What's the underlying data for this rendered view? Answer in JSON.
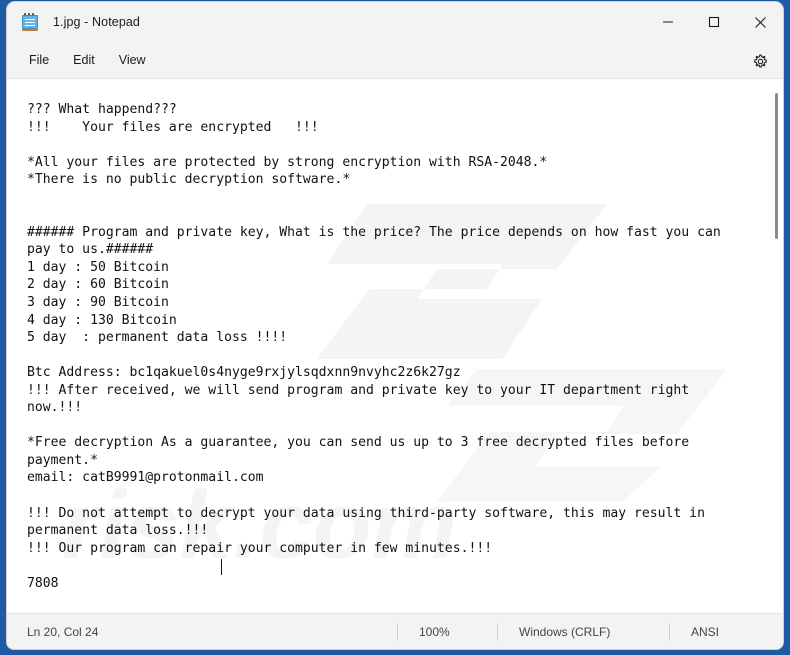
{
  "desktop": {
    "background_color": "#1f5aa6"
  },
  "window": {
    "title": "1.jpg - Notepad",
    "app_icon": "notepad-icon",
    "controls": {
      "minimize": "minimize-icon",
      "maximize": "maximize-icon",
      "close": "close-icon"
    }
  },
  "menubar": {
    "items": [
      {
        "label": "File"
      },
      {
        "label": "Edit"
      },
      {
        "label": "View"
      }
    ],
    "settings_icon": "gear-icon"
  },
  "editor": {
    "content": "??? What happend???\n!!!    Your files are encrypted   !!!\n\n*All your files are protected by strong encryption with RSA-2048.*\n*There is no public decryption software.*\n\n\n###### Program and private key, What is the price? The price depends on how fast you can\npay to us.######\n1 day : 50 Bitcoin\n2 day : 60 Bitcoin\n3 day : 90 Bitcoin\n4 day : 130 Bitcoin\n5 day  : permanent data loss !!!!\n\nBtc Address: bc1qakuel0s4nyge9rxjylsqdxnn9nvyhc2z6k27gz\n!!! After received, we will send program and private key to your IT department right\nnow.!!!\n\n*Free decryption As a guarantee, you can send us up to 3 free decrypted files before\npayment.*\nemail: catB9991@protonmail.com\n\n!!! Do not attempt to decrypt your data using third-party software, this may result in\npermanent data loss.!!!\n!!! Our program can repair your computer in few minutes.!!!\n\n7808",
    "ransom_note": {
      "headline_1": "??? What happend???",
      "headline_2": "!!!    Your files are encrypted   !!!",
      "encryption_line": "*All your files are protected by strong encryption with RSA-2048.*",
      "no_software_line": "*There is no public decryption software.*",
      "price_intro": "###### Program and private key, What is the price? The price depends on how fast you can pay to us.######",
      "price_table": [
        {
          "day": "1 day",
          "price": "50 Bitcoin"
        },
        {
          "day": "2 day",
          "price": "60 Bitcoin"
        },
        {
          "day": "3 day",
          "price": "90 Bitcoin"
        },
        {
          "day": "4 day",
          "price": "130 Bitcoin"
        },
        {
          "day": "5 day",
          "price": "permanent data loss !!!!"
        }
      ],
      "btc_address_label": "Btc Address:",
      "btc_address": "bc1qakuel0s4nyge9rxjylsqdxnn9nvyhc2z6k27gz",
      "after_received": "!!! After received, we will send program and private key to your IT department right now.!!!",
      "free_decryption": "*Free decryption As a guarantee, you can send us up to 3 free decrypted files before payment.*",
      "email_label": "email:",
      "email": "catB9991@protonmail.com",
      "warning_1": "!!! Do not attempt to decrypt your data using third-party software, this may result in permanent data loss.!!!",
      "warning_2": "!!! Our program can repair your computer in few minutes.!!!",
      "id_number": "7808"
    }
  },
  "statusbar": {
    "position": "Ln 20, Col 24",
    "zoom": "100%",
    "line_ending": "Windows (CRLF)",
    "encoding": "ANSI"
  }
}
